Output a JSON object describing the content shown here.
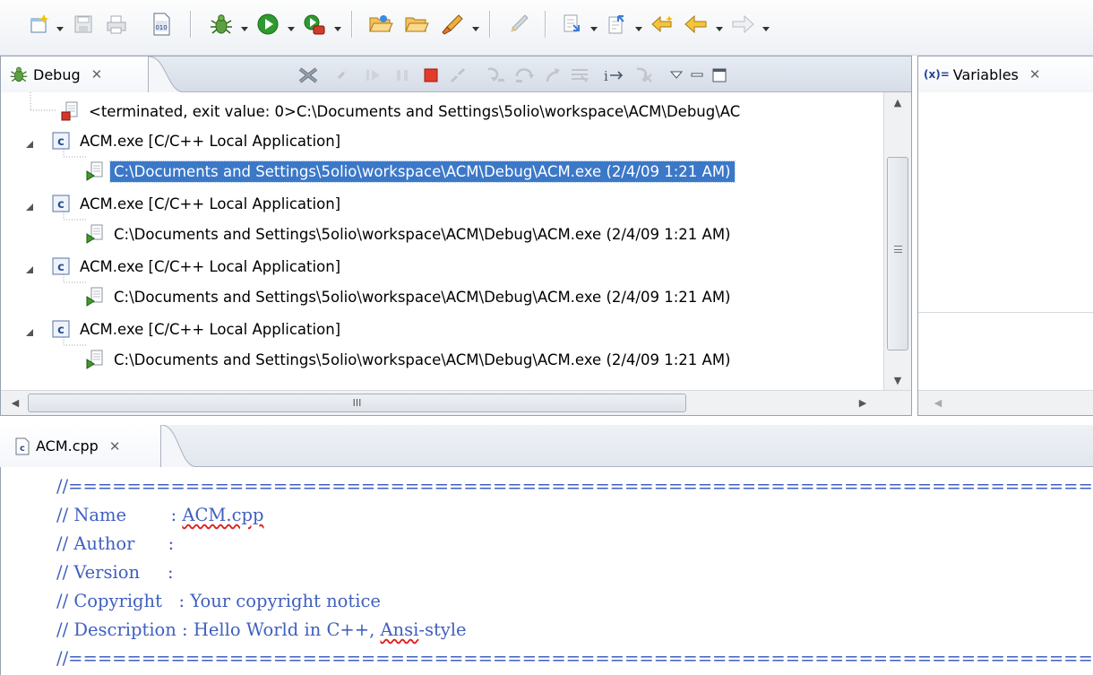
{
  "debug_view": {
    "tab_label": "Debug",
    "tree": [
      {
        "kind": "terminated",
        "text": "<terminated, exit value: 0>C:\\Documents and Settings\\5olio\\workspace\\ACM\\Debug\\AC"
      },
      {
        "kind": "launch",
        "text": "ACM.exe [C/C++ Local Application]"
      },
      {
        "kind": "process",
        "text": "C:\\Documents and Settings\\5olio\\workspace\\ACM\\Debug\\ACM.exe (2/4/09 1:21 AM)",
        "selected": true
      },
      {
        "kind": "launch",
        "text": "ACM.exe [C/C++ Local Application]"
      },
      {
        "kind": "process",
        "text": "C:\\Documents and Settings\\5olio\\workspace\\ACM\\Debug\\ACM.exe (2/4/09 1:21 AM)"
      },
      {
        "kind": "launch",
        "text": "ACM.exe [C/C++ Local Application]"
      },
      {
        "kind": "process",
        "text": "C:\\Documents and Settings\\5olio\\workspace\\ACM\\Debug\\ACM.exe (2/4/09 1:21 AM)"
      },
      {
        "kind": "launch",
        "text": "ACM.exe [C/C++ Local Application]"
      },
      {
        "kind": "process",
        "text": "C:\\Documents and Settings\\5olio\\workspace\\ACM\\Debug\\ACM.exe (2/4/09 1:21 AM)"
      }
    ],
    "hscroll_grip": "III"
  },
  "variables_view": {
    "tab_label": "Variables"
  },
  "editor": {
    "tab_label": "ACM.cpp",
    "lines": [
      "//============================================================================",
      "// Name        : ACM.cpp",
      "// Author      :",
      "// Version     :",
      "// Copyright   : Your copyright notice",
      "// Description : Hello World in C++, Ansi-style",
      "//============================================================================"
    ]
  },
  "colors": {
    "selection": "#3c78c8",
    "comment": "#3f5fbf",
    "tab_border": "#99a3b1"
  },
  "icons": {
    "toolbar": [
      "new-wizard-icon",
      "save-icon",
      "print-icon",
      "binary-file-icon",
      "debug-bug-icon",
      "run-icon",
      "external-tools-icon",
      "open-project-icon",
      "open-folder-icon",
      "build-brush-icon",
      "pen-disabled-icon",
      "next-annotation-icon",
      "previous-annotation-icon",
      "last-edit-icon",
      "back-arrow-icon",
      "forward-arrow-icon"
    ],
    "debug_view": [
      "remove-terminated-icon",
      "connect-icon",
      "resume-icon",
      "suspend-icon",
      "terminate-icon",
      "disconnect-icon",
      "step-into-icon",
      "step-over-icon",
      "step-return-icon",
      "drop-to-frame-icon",
      "instruction-step-icon",
      "use-step-filters-icon",
      "view-menu-icon",
      "minimize-icon",
      "maximize-icon"
    ]
  }
}
